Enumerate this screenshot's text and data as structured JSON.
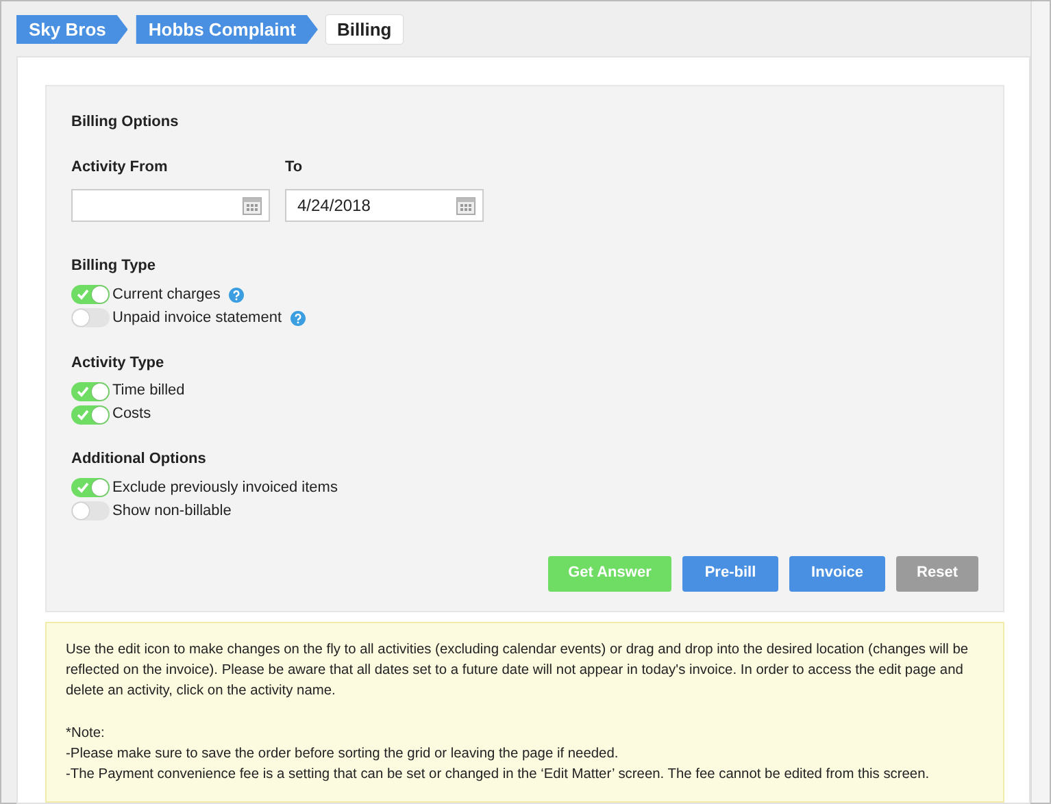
{
  "breadcrumb": [
    {
      "label": "Sky Bros",
      "selected": false
    },
    {
      "label": "Hobbs Complaint",
      "selected": false
    },
    {
      "label": "Billing",
      "selected": true
    }
  ],
  "billing_options": {
    "title": "Billing Options",
    "date_fields": [
      {
        "label": "Activity From"
      },
      {
        "label": "To",
        "value": "4/24/2018"
      }
    ],
    "groups": [
      {
        "title": "Billing Type",
        "options": [
          {
            "label": "Current charges",
            "on": true,
            "help": true
          },
          {
            "label": "Unpaid invoice statement",
            "on": false,
            "help": true
          }
        ]
      },
      {
        "title": "Activity Type",
        "options": [
          {
            "label": "Time billed",
            "on": true,
            "help": false
          },
          {
            "label": "Costs",
            "on": true,
            "help": false
          }
        ]
      },
      {
        "title": "Additional Options",
        "options": [
          {
            "label": "Exclude previously invoiced items",
            "on": true,
            "help": false
          },
          {
            "label": "Show non-billable",
            "on": false,
            "help": false
          }
        ]
      }
    ],
    "buttons": [
      {
        "label": "Get Answer",
        "kind": "success"
      },
      {
        "label": "Pre-bill",
        "kind": "primary"
      },
      {
        "label": "Invoice",
        "kind": "primary"
      },
      {
        "label": "Reset",
        "kind": "secondary"
      }
    ]
  },
  "note": {
    "paragraph": "Use the edit icon to make changes on the fly to all activities (excluding calendar events) or drag and drop into the desired location (changes will be reflected on the invoice). Please be aware that all dates set to a future date will not appear in today's invoice. In order to access the edit page and delete an activity, click on the activity name.",
    "lines": [
      "*Note:",
      "-Please make sure to save the order before sorting the grid or leaving the page if needed.",
      "-The Payment convenience fee is a setting that can be set or changed in the ‘Edit Matter’ screen. The fee cannot be edited from this screen."
    ]
  }
}
